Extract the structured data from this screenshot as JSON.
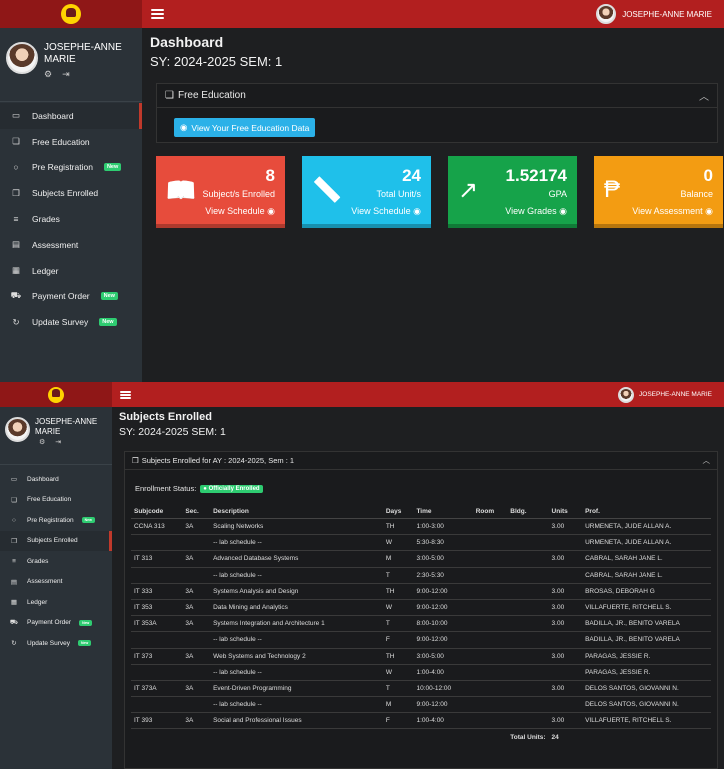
{
  "user": {
    "name": "JOSEPHE-ANNE MARIE"
  },
  "menu": [
    {
      "label": "Dashboard",
      "icon": "monitor-icon",
      "glyph": "▭"
    },
    {
      "label": "Free Education",
      "icon": "gift-icon",
      "glyph": "❏"
    },
    {
      "label": "Pre Registration",
      "icon": "circle-icon",
      "glyph": "○",
      "badge": "New"
    },
    {
      "label": "Subjects Enrolled",
      "icon": "book-icon",
      "glyph": "❒"
    },
    {
      "label": "Grades",
      "icon": "list-icon",
      "glyph": "≡"
    },
    {
      "label": "Assessment",
      "icon": "id-card-icon",
      "glyph": "▤"
    },
    {
      "label": "Ledger",
      "icon": "ledger-icon",
      "glyph": "▦"
    },
    {
      "label": "Payment Order",
      "icon": "cart-icon",
      "glyph": "⛟",
      "badge": "New"
    },
    {
      "label": "Update Survey",
      "icon": "refresh-icon",
      "glyph": "↻",
      "badge": "New"
    }
  ],
  "dashboard": {
    "title": "Dashboard",
    "subtitle": "SY: 2024-2025 SEM: 1",
    "free_ed_title": "Free Education",
    "free_ed_button": "View Your Free Education Data",
    "stats": [
      {
        "value": "8",
        "label": "Subject/s Enrolled",
        "link": "View Schedule",
        "color": "#e74c3c",
        "icon": "book-open-icon"
      },
      {
        "value": "24",
        "label": "Total Unit/s",
        "link": "View Schedule",
        "color": "#1fc0ea",
        "icon": "ruler-icon"
      },
      {
        "value": "1.52174",
        "label": "GPA",
        "link": "View Grades",
        "color": "#16a34a",
        "icon": "trend-icon"
      },
      {
        "value": "0",
        "label": "Balance",
        "link": "View Assessment",
        "color": "#f39c12",
        "icon": "peso-icon"
      }
    ]
  },
  "subjects": {
    "title": "Subjects Enrolled",
    "subtitle": "SY: 2024-2025 SEM: 1",
    "card_title": "Subjects Enrolled for AY : 2024-2025, Sem : 1",
    "status_label": "Enrollment Status:",
    "status_badge": "Officially Enrolled",
    "columns": [
      "Subjcode",
      "Sec.",
      "Description",
      "Days",
      "Time",
      "Room",
      "Bldg.",
      "Units",
      "Prof."
    ],
    "rows": [
      [
        "CCNA 313",
        "3A",
        "Scaling Networks",
        "TH",
        "1:00-3:00",
        "",
        "",
        "3.00",
        "URMENETA, JUDE ALLAN A."
      ],
      [
        "",
        "",
        "-- lab schedule --",
        "W",
        "5:30-8:30",
        "",
        "",
        "",
        "URMENETA, JUDE ALLAN A."
      ],
      [
        "IT 313",
        "3A",
        "Advanced Database Systems",
        "M",
        "3:00-5:00",
        "",
        "",
        "3.00",
        "CABRAL, SARAH JANE L."
      ],
      [
        "",
        "",
        "-- lab schedule --",
        "T",
        "2:30-5:30",
        "",
        "",
        "",
        "CABRAL, SARAH JANE L."
      ],
      [
        "IT 333",
        "3A",
        "Systems Analysis and Design",
        "TH",
        "9:00-12:00",
        "",
        "",
        "3.00",
        "BROSAS, DEBORAH G"
      ],
      [
        "IT 353",
        "3A",
        "Data Mining and Analytics",
        "W",
        "9:00-12:00",
        "",
        "",
        "3.00",
        "VILLAFUERTE, RITCHELL S."
      ],
      [
        "IT 353A",
        "3A",
        "Systems Integration and Architecture 1",
        "T",
        "8:00-10:00",
        "",
        "",
        "3.00",
        "BADILLA, JR., BENITO VARELA"
      ],
      [
        "",
        "",
        "-- lab schedule --",
        "F",
        "9:00-12:00",
        "",
        "",
        "",
        "BADILLA, JR., BENITO VARELA"
      ],
      [
        "IT 373",
        "3A",
        "Web Systems and Technology 2",
        "TH",
        "3:00-5:00",
        "",
        "",
        "3.00",
        "PARAGAS, JESSIE R."
      ],
      [
        "",
        "",
        "-- lab schedule --",
        "W",
        "1:00-4:00",
        "",
        "",
        "",
        "PARAGAS, JESSIE R."
      ],
      [
        "IT 373A",
        "3A",
        "Event-Driven Programming",
        "T",
        "10:00-12:00",
        "",
        "",
        "3.00",
        "DELOS SANTOS, GIOVANNI N."
      ],
      [
        "",
        "",
        "-- lab schedule --",
        "M",
        "9:00-12:00",
        "",
        "",
        "",
        "DELOS SANTOS, GIOVANNI N."
      ],
      [
        "IT 393",
        "3A",
        "Social and Professional Issues",
        "F",
        "1:00-4:00",
        "",
        "",
        "3.00",
        "VILLAFUERTE, RITCHELL S."
      ]
    ],
    "total_label": "Total Units:",
    "total_value": "24"
  }
}
